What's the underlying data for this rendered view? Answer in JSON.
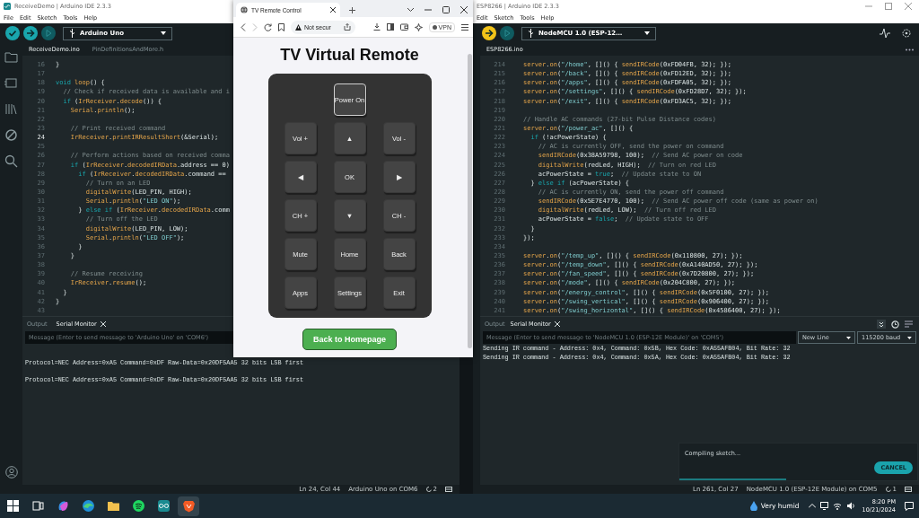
{
  "left_ide": {
    "title": "ReceiveDemo | Arduino IDE 2.3.3",
    "menu": [
      "File",
      "Edit",
      "Sketch",
      "Tools",
      "Help"
    ],
    "toolbar": {
      "upload_active": false,
      "board": "Arduino Uno"
    },
    "editor_tabs": [
      {
        "label": "ReceiveDemo.ino",
        "selected": true
      },
      {
        "label": "PinDefinitionsAndMore.h",
        "selected": false
      }
    ],
    "code_lines": [
      {
        "number": "16",
        "text": "}",
        "current": false
      },
      {
        "number": "17",
        "current": false
      },
      {
        "number": "18",
        "text": "void loop() {",
        "current": false
      },
      {
        "number": "19",
        "text": "  // Check if received data is available and i",
        "current": false
      },
      {
        "number": "20",
        "text": "  if (IrReceiver.decode()) {",
        "current": false
      },
      {
        "number": "21",
        "text": "    Serial.println();",
        "current": false
      },
      {
        "number": "22",
        "current": false
      },
      {
        "number": "23",
        "text": "    // Print received command",
        "current": false
      },
      {
        "number": "24",
        "text": "    IrReceiver.printIRResultShort(&Serial);",
        "current": true
      },
      {
        "number": "25",
        "current": false
      },
      {
        "number": "26",
        "text": "    // Perform actions based on received comma",
        "current": false
      },
      {
        "number": "27",
        "text": "    if (IrReceiver.decodedIRData.address == 0)",
        "current": false
      },
      {
        "number": "28",
        "text": "      if (IrReceiver.decodedIRData.command ==",
        "current": false
      },
      {
        "number": "29",
        "text": "        // Turn on an LED",
        "current": false
      },
      {
        "number": "30",
        "text": "        digitalWrite(LED_PIN, HIGH);",
        "current": false
      },
      {
        "number": "31",
        "text": "        Serial.println(\"LED ON\");",
        "current": false
      },
      {
        "number": "32",
        "text": "      } else if (IrReceiver.decodedIRData.comm",
        "current": false
      },
      {
        "number": "33",
        "text": "        // Turn off the LED",
        "current": false
      },
      {
        "number": "34",
        "text": "        digitalWrite(LED_PIN, LOW);",
        "current": false
      },
      {
        "number": "35",
        "text": "        Serial.println(\"LED OFF\");",
        "current": false
      },
      {
        "number": "36",
        "text": "      }",
        "current": false
      },
      {
        "number": "37",
        "text": "    }",
        "current": false
      },
      {
        "number": "38",
        "current": false
      },
      {
        "number": "39",
        "text": "    // Resume receiving",
        "current": false
      },
      {
        "number": "40",
        "text": "    IrReceiver.resume();",
        "current": false
      },
      {
        "number": "41",
        "text": "  }",
        "current": false
      },
      {
        "number": "42",
        "text": "}",
        "current": false
      },
      {
        "number": "43",
        "current": false
      }
    ],
    "panel": {
      "tabs": [
        {
          "label": "Output",
          "selected": false
        },
        {
          "label": "Serial Monitor",
          "selected": true
        }
      ],
      "message_placeholder": "Message (Enter to send message to 'Arduino Uno' on 'COM6')",
      "output": [
        {
          "text": "Protocol=NEC Address=0xA5 Command=0xDF Raw-Data=0x20DF5AA5 32 bits LSB first",
          "blank_line_before": true
        },
        {
          "text": "Protocol=NEC Address=0xA5 Command=0xDF Raw-Data=0x20DF5AA5 32 bits LSB first",
          "blank_line_before": true
        }
      ]
    },
    "status_bar": {
      "position": "Ln 24, Col 44",
      "board": "Arduino Uno on COM6",
      "notifications": "2"
    }
  },
  "browser": {
    "tab": {
      "title": "TV Remote Control"
    },
    "navigation": {
      "forward_disabled": true
    },
    "address": {
      "text": "Not secur"
    },
    "vpn": "VPN",
    "page": {
      "heading": "TV Virtual Remote",
      "rows": [
        {
          "buttons": [
            {
              "label": "Power On",
              "focused": true
            }
          ]
        },
        {
          "buttons": [
            {
              "label": "Vol +",
              "focused": false
            },
            {
              "label": "▲",
              "focused": false
            },
            {
              "label": "Vol -",
              "focused": false
            }
          ]
        },
        {
          "buttons": [
            {
              "label": "◀",
              "focused": false
            },
            {
              "label": "OK",
              "focused": false
            },
            {
              "label": "▶",
              "focused": false
            }
          ]
        },
        {
          "buttons": [
            {
              "label": "CH +",
              "focused": false
            },
            {
              "label": "▼",
              "focused": false
            },
            {
              "label": "CH -",
              "focused": false
            }
          ]
        },
        {
          "buttons": [
            {
              "label": "Mute",
              "focused": false
            },
            {
              "label": "Home",
              "focused": false
            },
            {
              "label": "Back",
              "focused": false
            }
          ]
        },
        {
          "buttons": [
            {
              "label": "Apps",
              "focused": false
            },
            {
              "label": "Settings",
              "focused": false
            },
            {
              "label": "Exit",
              "focused": false
            }
          ]
        }
      ],
      "link_button": "Back to Homepage"
    }
  },
  "right_ide": {
    "title": "ESP8266 | Arduino IDE 2.3.3",
    "menu": [
      "Edit",
      "Sketch",
      "Tools",
      "Help"
    ],
    "toolbar": {
      "upload_active": true,
      "board": "NodeMCU 1.0 (ESP-12…"
    },
    "editor_tabs": [
      {
        "label": "ESP8266.ino",
        "selected": true
      }
    ],
    "code_lines": [
      {
        "number": "214",
        "text": "server.on(\"/home\", []() { sendIRCode(0xFD04FB, 32); });",
        "current": false
      },
      {
        "number": "215",
        "text": "server.on(\"/back\", []() { sendIRCode(0xFD12ED, 32); });",
        "current": false
      },
      {
        "number": "216",
        "text": "server.on(\"/apps\", []() { sendIRCode(0xFDFA05, 32); });",
        "current": false
      },
      {
        "number": "217",
        "text": "server.on(\"/settings\", []() { sendIRCode(0xFD28D7, 32); });",
        "current": false
      },
      {
        "number": "218",
        "text": "server.on(\"/exit\", []() { sendIRCode(0xFD3AC5, 32); });",
        "current": false
      },
      {
        "number": "219",
        "current": false
      },
      {
        "number": "220",
        "text": "// Handle AC commands (27-bit Pulse Distance codes)",
        "current": false
      },
      {
        "number": "221",
        "text": "server.on(\"/power_ac\", []() {",
        "current": false
      },
      {
        "number": "222",
        "text": "  if (!acPowerState) {",
        "current": false
      },
      {
        "number": "223",
        "text": "    // AC is currently OFF, send the power on command",
        "current": false
      },
      {
        "number": "224",
        "text": "    sendIRCode(0x38A59798, 100);  // Send AC power on code",
        "current": false
      },
      {
        "number": "225",
        "text": "    digitalWrite(redLed, HIGH);  // Turn on red LED",
        "current": false
      },
      {
        "number": "226",
        "text": "    acPowerState = true;  // Update state to ON",
        "current": false
      },
      {
        "number": "227",
        "text": "  } else if (acPowerState) {",
        "current": false
      },
      {
        "number": "228",
        "text": "    // AC is currently ON, send the power off command",
        "current": false
      },
      {
        "number": "229",
        "text": "    sendIRCode(0x5E7E4770, 100);  // Send AC power off code (same as power on)",
        "current": false
      },
      {
        "number": "230",
        "text": "    digitalWrite(redLed, LOW);  // Turn off red LED",
        "current": false
      },
      {
        "number": "231",
        "text": "    acPowerState = false;  // Update state to OFF",
        "current": false
      },
      {
        "number": "232",
        "text": "  }",
        "current": false
      },
      {
        "number": "233",
        "text": "});",
        "current": false
      },
      {
        "number": "234",
        "current": false
      },
      {
        "number": "235",
        "text": "server.on(\"/temp_up\", []() { sendIRCode(0x110800, 27); });",
        "current": false
      },
      {
        "number": "236",
        "text": "server.on(\"/temp_down\", []() { sendIRCode(0xA140AD50, 27); });",
        "current": false
      },
      {
        "number": "237",
        "text": "server.on(\"/fan_speed\", []() { sendIRCode(0x7D20800, 27); });",
        "current": false
      },
      {
        "number": "238",
        "text": "server.on(\"/mode\", []() { sendIRCode(0x204C800, 27); });",
        "current": false
      },
      {
        "number": "239",
        "text": "server.on(\"/energy_control\", []() { sendIRCode(0x5F0100, 27); });",
        "current": false
      },
      {
        "number": "240",
        "text": "server.on(\"/swing_vertical\", []() { sendIRCode(0x906400, 27); });",
        "current": false
      },
      {
        "number": "241",
        "text": "server.on(\"/swing_horizontal\", []() { sendIRCode(0x4586400, 27); });",
        "current": false
      }
    ],
    "panel": {
      "tabs": [
        {
          "label": "Output",
          "selected": false
        },
        {
          "label": "Serial Monitor",
          "selected": true
        }
      ],
      "message_placeholder": "Message (Enter to send message to 'NodeMCU 1.0 (ESP-12E Module)' on 'COM5')",
      "line_ending": "New Line",
      "baud": "115200 baud",
      "output": [
        {
          "text": "Sending IR command - Address: 0x4, Command: 0x5B, Hex Code: 0xA55AFB04, Bit Rate: 32",
          "blank_line_before": false
        },
        {
          "text": "Sending IR command - Address: 0x4, Command: 0x5A, Hex Code: 0xA55AFB04, Bit Rate: 32",
          "blank_line_before": false
        }
      ]
    },
    "notification": {
      "message": "Compiling sketch...",
      "button": "CANCEL",
      "level": 0.45
    },
    "status_bar": {
      "position": "Ln 261, Col 27",
      "board": "NodeMCU 1.0 (ESP-12E Module) on COM5",
      "notifications": "1"
    }
  },
  "taskbar": {
    "apps": [
      {
        "kind": "start",
        "selected": false
      },
      {
        "kind": "task-view",
        "selected": false
      },
      {
        "kind": "swirl",
        "selected": false
      },
      {
        "kind": "wave",
        "selected": false
      },
      {
        "kind": "folder",
        "selected": false
      },
      {
        "kind": "music",
        "selected": false
      },
      {
        "kind": "infinity",
        "selected": false
      },
      {
        "kind": "shield",
        "selected": true
      }
    ],
    "weather": "Very humid",
    "time": "8:20 PM",
    "date": "10/21/2024"
  }
}
